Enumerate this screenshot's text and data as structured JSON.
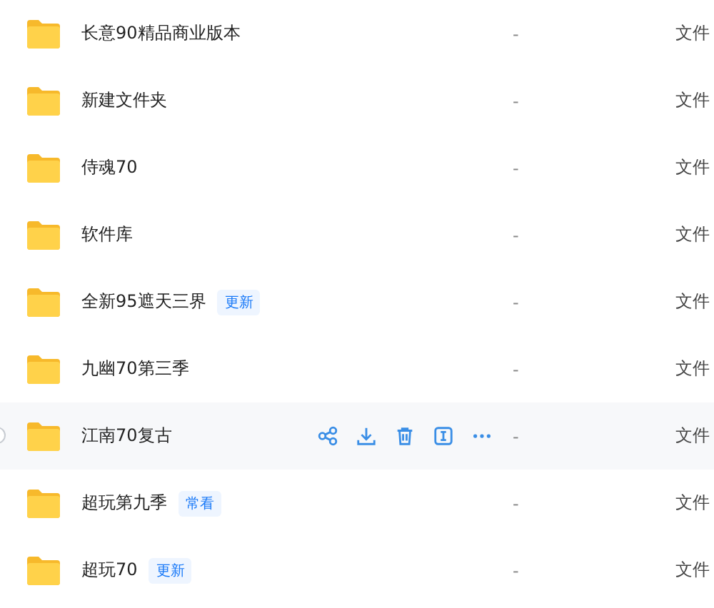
{
  "files": [
    {
      "name": "长意90精品商业版本",
      "size": "-",
      "type": "文件",
      "hovered": false
    },
    {
      "name": "新建文件夹",
      "size": "-",
      "type": "文件",
      "hovered": false
    },
    {
      "name": "侍魂70",
      "size": "-",
      "type": "文件",
      "hovered": false
    },
    {
      "name": "软件库",
      "size": "-",
      "type": "文件",
      "hovered": false
    },
    {
      "name": "全新95遮天三界",
      "tag": "更新",
      "size": "-",
      "type": "文件",
      "hovered": false
    },
    {
      "name": "九幽70第三季",
      "size": "-",
      "type": "文件",
      "hovered": false
    },
    {
      "name": "江南70复古",
      "size": "-",
      "type": "文件",
      "hovered": true
    },
    {
      "name": "超玩第九季",
      "tag": "常看",
      "size": "-",
      "type": "文件",
      "hovered": false
    },
    {
      "name": "超玩70",
      "tag": "更新",
      "size": "-",
      "type": "文件",
      "hovered": false
    }
  ]
}
